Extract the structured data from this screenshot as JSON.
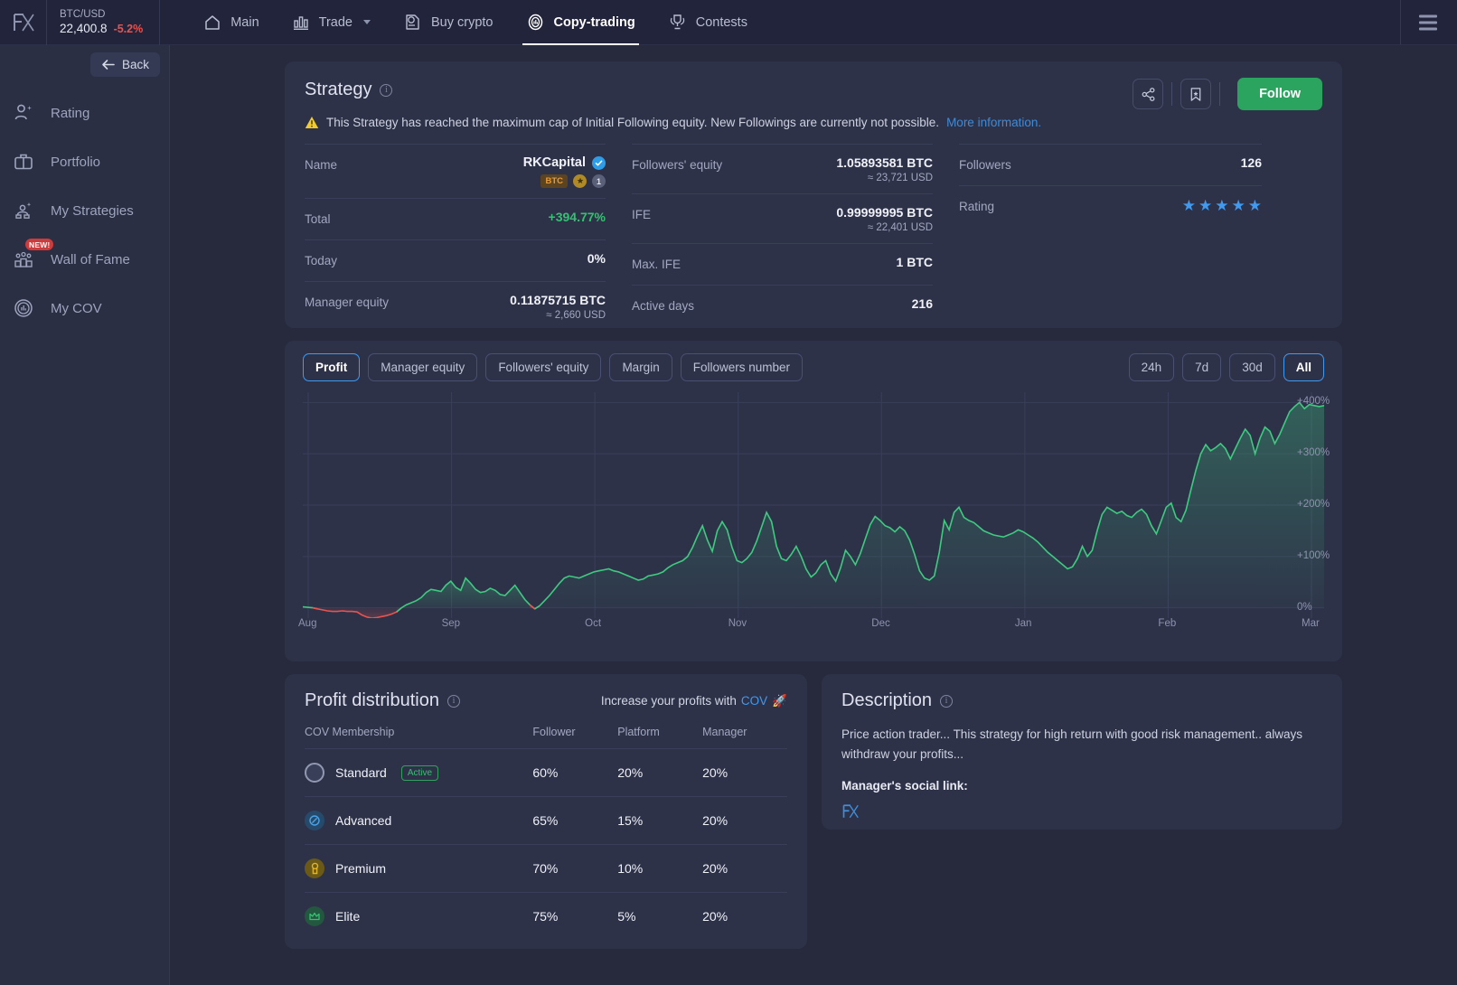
{
  "topbar": {
    "logo": "logo-mark",
    "ticker": {
      "pair": "BTC/USD",
      "price": "22,400.8",
      "change": "-5.2%"
    },
    "nav": [
      {
        "label": "Main",
        "icon": "home-icon",
        "active": false
      },
      {
        "label": "Trade",
        "icon": "bar-chart-icon",
        "active": false,
        "caret": true
      },
      {
        "label": "Buy crypto",
        "icon": "buy-crypto-icon",
        "active": false
      },
      {
        "label": "Copy-trading",
        "icon": "copy-trading-icon",
        "active": true
      },
      {
        "label": "Contests",
        "icon": "trophy-icon",
        "active": false
      }
    ]
  },
  "sidebar": {
    "back_label": "Back",
    "items": [
      {
        "label": "Rating",
        "icon": "user-star-icon",
        "badge": ""
      },
      {
        "label": "Portfolio",
        "icon": "briefcase-icon",
        "badge": ""
      },
      {
        "label": "My Strategies",
        "icon": "strategies-icon",
        "badge": ""
      },
      {
        "label": "Wall of Fame",
        "icon": "podium-icon",
        "badge": "NEW!"
      },
      {
        "label": "My COV",
        "icon": "cov-icon",
        "badge": ""
      }
    ]
  },
  "strategy": {
    "title": "Strategy",
    "warning": "This Strategy has reached the maximum cap of Initial Following equity. New Followings are currently not possible.",
    "warning_link": "More information.",
    "follow_label": "Follow",
    "share_icon": "share-icon",
    "bookmark_icon": "bookmark-icon",
    "col1": [
      {
        "label": "Name",
        "value": "RKCapital",
        "verified": true,
        "tags": [
          "BTC",
          "1",
          "1"
        ]
      },
      {
        "label": "Total",
        "value": "+394.77%",
        "accent": "#34c171"
      },
      {
        "label": "Today",
        "value": "0%"
      },
      {
        "label": "Manager equity",
        "value": "0.11875715 BTC",
        "sub": "≈ 2,660 USD"
      }
    ],
    "col2": [
      {
        "label": "Followers' equity",
        "value": "1.05893581 BTC",
        "sub": "≈ 23,721 USD"
      },
      {
        "label": "IFE",
        "value": "0.99999995 BTC",
        "sub": "≈ 22,401 USD"
      },
      {
        "label": "Max. IFE",
        "value": "1 BTC"
      },
      {
        "label": "Active days",
        "value": "216"
      }
    ],
    "col3": [
      {
        "label": "Followers",
        "value": "126"
      },
      {
        "label": "Rating",
        "value": "",
        "stars": 5
      }
    ]
  },
  "chart_panel": {
    "metric_tabs": [
      {
        "label": "Profit",
        "selected": true
      },
      {
        "label": "Manager equity",
        "selected": false
      },
      {
        "label": "Followers' equity",
        "selected": false
      },
      {
        "label": "Margin",
        "selected": false
      },
      {
        "label": "Followers number",
        "selected": false
      }
    ],
    "range_tabs": [
      {
        "label": "24h",
        "selected": false
      },
      {
        "label": "7d",
        "selected": false
      },
      {
        "label": "30d",
        "selected": false
      },
      {
        "label": "All",
        "selected": true
      }
    ]
  },
  "chart_data": {
    "type": "area",
    "title": "Profit",
    "xlabel": "",
    "ylabel": "",
    "ylim": [
      -20,
      420
    ],
    "ytick_labels": [
      "+400%",
      "+300%",
      "+200%",
      "+100%",
      "0%"
    ],
    "ytick_values": [
      400,
      300,
      200,
      100,
      0
    ],
    "xtick_labels": [
      "Aug",
      "Sep",
      "Oct",
      "Nov",
      "Dec",
      "Jan",
      "Feb",
      "Mar"
    ],
    "grid": true,
    "legend": "none",
    "positive_color": "#3ecb80",
    "negative_color": "#e8534f",
    "series": [
      {
        "name": "Profit %",
        "values": [
          2,
          1,
          0,
          -2,
          -4,
          -6,
          -7,
          -7,
          -6,
          -7,
          -7,
          -8,
          -14,
          -18,
          -20,
          -19,
          -17,
          -15,
          -12,
          -8,
          0,
          6,
          10,
          14,
          20,
          30,
          36,
          34,
          32,
          44,
          52,
          40,
          34,
          58,
          48,
          36,
          30,
          32,
          38,
          34,
          26,
          24,
          34,
          44,
          30,
          16,
          6,
          -2,
          4,
          14,
          24,
          36,
          48,
          58,
          62,
          60,
          58,
          62,
          66,
          70,
          72,
          74,
          76,
          72,
          70,
          66,
          62,
          58,
          54,
          56,
          62,
          64,
          66,
          70,
          78,
          84,
          88,
          92,
          100,
          118,
          140,
          160,
          132,
          110,
          150,
          168,
          152,
          118,
          92,
          88,
          96,
          108,
          130,
          158,
          186,
          168,
          120,
          96,
          92,
          104,
          120,
          100,
          76,
          60,
          68,
          84,
          92,
          66,
          52,
          78,
          112,
          100,
          84,
          106,
          134,
          162,
          178,
          170,
          160,
          156,
          148,
          158,
          150,
          132,
          104,
          72,
          58,
          54,
          62,
          108,
          170,
          152,
          186,
          196,
          176,
          170,
          166,
          158,
          150,
          146,
          142,
          140,
          138,
          142,
          146,
          152,
          148,
          142,
          136,
          128,
          118,
          108,
          100,
          92,
          84,
          76,
          80,
          96,
          120,
          100,
          112,
          150,
          182,
          196,
          190,
          184,
          188,
          180,
          176,
          186,
          192,
          182,
          160,
          144,
          170,
          196,
          204,
          176,
          168,
          190,
          230,
          268,
          300,
          318,
          306,
          312,
          320,
          310,
          290,
          310,
          330,
          348,
          336,
          300,
          330,
          352,
          344,
          320,
          338,
          360,
          382,
          392,
          400,
          388,
          396,
          394,
          392,
          394
        ]
      }
    ]
  },
  "profit_distribution": {
    "title": "Profit distribution",
    "promo_prefix": "Increase your profits with",
    "promo_link": "COV",
    "promo_icon": "rocket-icon",
    "columns": [
      "COV Membership",
      "Follower",
      "Platform",
      "Manager"
    ],
    "rows": [
      {
        "tier": "Standard",
        "badge": "Active",
        "icon": "circle-icon",
        "follower": "60%",
        "platform": "20%",
        "manager": "20%"
      },
      {
        "tier": "Advanced",
        "badge": "",
        "icon": "advanced-icon",
        "follower": "65%",
        "platform": "15%",
        "manager": "20%"
      },
      {
        "tier": "Premium",
        "badge": "",
        "icon": "medal-icon",
        "follower": "70%",
        "platform": "10%",
        "manager": "20%"
      },
      {
        "tier": "Elite",
        "badge": "",
        "icon": "crown-icon",
        "follower": "75%",
        "platform": "5%",
        "manager": "20%"
      }
    ]
  },
  "description": {
    "title": "Description",
    "body": "Price action trader... This strategy for high return with good risk management.. always withdraw your profits...",
    "social_label": "Manager's social link:",
    "social_icon": "fx-logo-icon"
  }
}
